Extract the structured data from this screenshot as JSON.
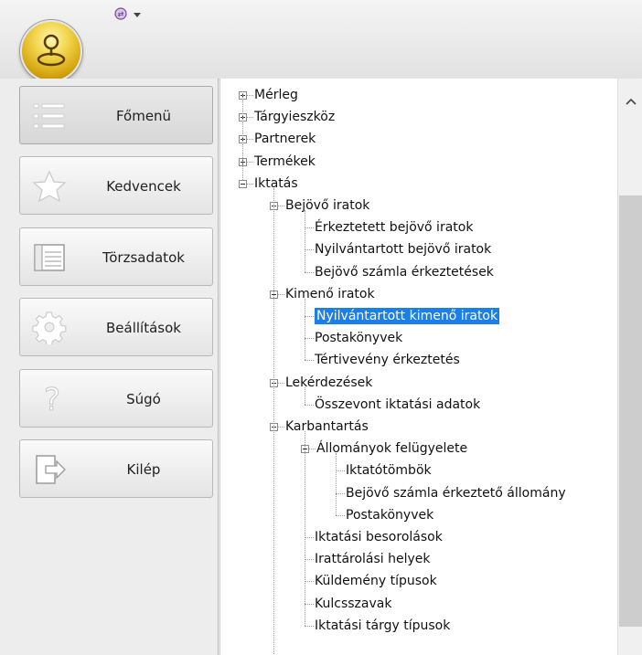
{
  "sidebar": {
    "items": [
      {
        "label": "Főmenü",
        "icon": "menu-list-icon",
        "active": true
      },
      {
        "label": "Kedvencek",
        "icon": "star-icon"
      },
      {
        "label": "Törzsadatok",
        "icon": "table-icon"
      },
      {
        "label": "Beállítások",
        "icon": "gear-icon"
      },
      {
        "label": "Súgó",
        "icon": "question-icon"
      },
      {
        "label": "Kilép",
        "icon": "exit-icon"
      }
    ]
  },
  "tree": {
    "nodes": [
      {
        "label": "Mérleg",
        "level": 0,
        "state": "collapsed"
      },
      {
        "label": "Tárgyieszköz",
        "level": 0,
        "state": "collapsed"
      },
      {
        "label": "Partnerek",
        "level": 0,
        "state": "collapsed"
      },
      {
        "label": "Termékek",
        "level": 0,
        "state": "collapsed"
      },
      {
        "label": "Iktatás",
        "level": 0,
        "state": "expanded"
      },
      {
        "label": "Bejövő iratok",
        "level": 1,
        "state": "expanded"
      },
      {
        "label": "Érkeztetett bejövő iratok",
        "level": 2,
        "state": "leaf"
      },
      {
        "label": "Nyilvántartott bejövő iratok",
        "level": 2,
        "state": "leaf"
      },
      {
        "label": "Bejövő számla érkeztetések",
        "level": 2,
        "state": "leaf"
      },
      {
        "label": "Kimenő iratok",
        "level": 1,
        "state": "expanded"
      },
      {
        "label": "Nyilvántartott kimenő iratok",
        "level": 2,
        "state": "leaf",
        "selected": true
      },
      {
        "label": "Postakönyvek",
        "level": 2,
        "state": "leaf"
      },
      {
        "label": "Tértivevény érkeztetés",
        "level": 2,
        "state": "leaf"
      },
      {
        "label": "Lekérdezések",
        "level": 1,
        "state": "expanded"
      },
      {
        "label": "Összevont iktatási adatok",
        "level": 2,
        "state": "leaf"
      },
      {
        "label": "Karbantartás",
        "level": 1,
        "state": "expanded"
      },
      {
        "label": "Állományok felügyelete",
        "level": 2,
        "state": "expanded"
      },
      {
        "label": "Iktatótömbök",
        "level": 3,
        "state": "leaf"
      },
      {
        "label": "Bejövő számla érkeztető állomány",
        "level": 3,
        "state": "leaf"
      },
      {
        "label": "Postakönyvek",
        "level": 3,
        "state": "leaf"
      },
      {
        "label": "Iktatási besorolások",
        "level": 2,
        "state": "leaf"
      },
      {
        "label": "Irattárolási helyek",
        "level": 2,
        "state": "leaf"
      },
      {
        "label": "Küldemény típusok",
        "level": 2,
        "state": "leaf"
      },
      {
        "label": "Kulcsszavak",
        "level": 2,
        "state": "leaf"
      },
      {
        "label": "Iktatási tárgy típusok",
        "level": 2,
        "state": "leaf"
      }
    ]
  },
  "colors": {
    "selection": "#1c7ee8",
    "orb": "#e8c22e"
  }
}
